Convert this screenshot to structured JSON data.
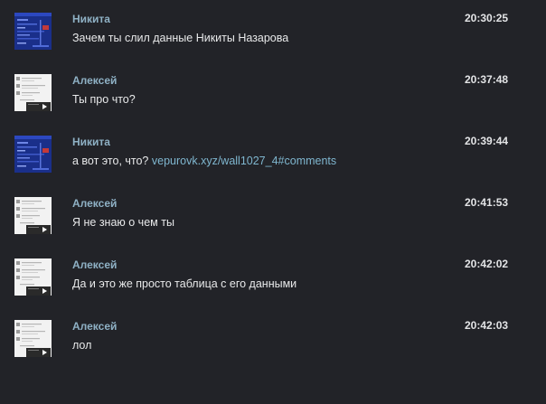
{
  "messages": [
    {
      "author": "Никита",
      "avatar": "blue-screenshot-avatar",
      "text": "Зачем ты слил данные Никиты Назарова",
      "link": "",
      "time": "20:30:25"
    },
    {
      "author": "Алексей",
      "avatar": "white-screenshot-avatar",
      "text": "Ты про что?",
      "link": "",
      "time": "20:37:48"
    },
    {
      "author": "Никита",
      "avatar": "blue-screenshot-avatar",
      "text": "а вот это, что? ",
      "link": "vepurovk.xyz/wall1027_4#comments",
      "time": "20:39:44"
    },
    {
      "author": "Алексей",
      "avatar": "white-screenshot-avatar",
      "text": "Я не знаю о чем ты",
      "link": "",
      "time": "20:41:53"
    },
    {
      "author": "Алексей",
      "avatar": "white-screenshot-avatar",
      "text": "Да и это же просто таблица с его данными",
      "link": "",
      "time": "20:42:02"
    },
    {
      "author": "Алексей",
      "avatar": "white-screenshot-avatar",
      "text": "лол",
      "link": "",
      "time": "20:42:03"
    }
  ],
  "colors": {
    "background": "#222328",
    "author": "#8fb1c5",
    "text": "#e8e9ea",
    "link": "#7fb6cf",
    "time": "#e3e4e6"
  }
}
